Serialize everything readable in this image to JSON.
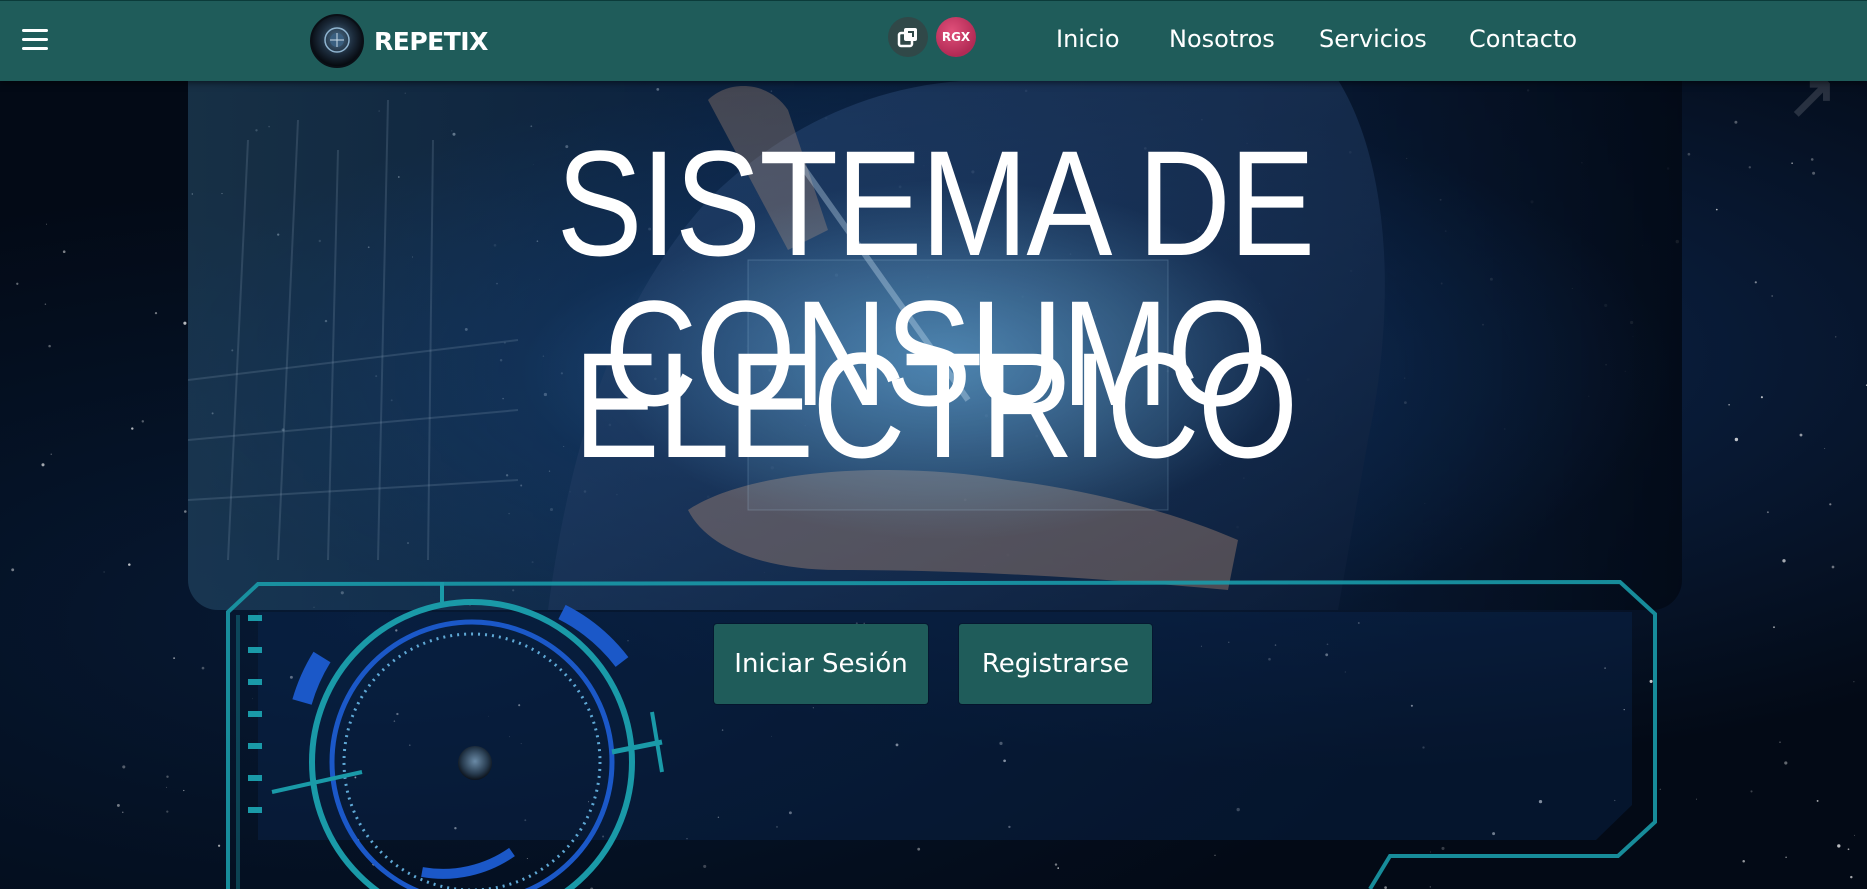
{
  "navbar": {
    "brand_name": "REPETIX",
    "rgx_label": "RGX",
    "links": [
      {
        "label": "Inicio"
      },
      {
        "label": "Nosotros"
      },
      {
        "label": "Servicios"
      },
      {
        "label": "Contacto"
      }
    ]
  },
  "hero": {
    "title_line1": "SISTEMA DE CONSUMO",
    "title_line2": "ELECTRICO"
  },
  "actions": {
    "login_label": "Iniciar Sesión",
    "register_label": "Registrarse"
  },
  "colors": {
    "navbar_bg": "#1f5c5a",
    "button_bg": "#1f5c5a",
    "rgx_badge": "#c2355f",
    "hud_cyan": "#1a9aa8",
    "hud_blue": "#1b58c8",
    "page_bg": "#030a16"
  },
  "icons": {
    "menu": "hamburger-icon",
    "copy": "copy-window-icon"
  }
}
